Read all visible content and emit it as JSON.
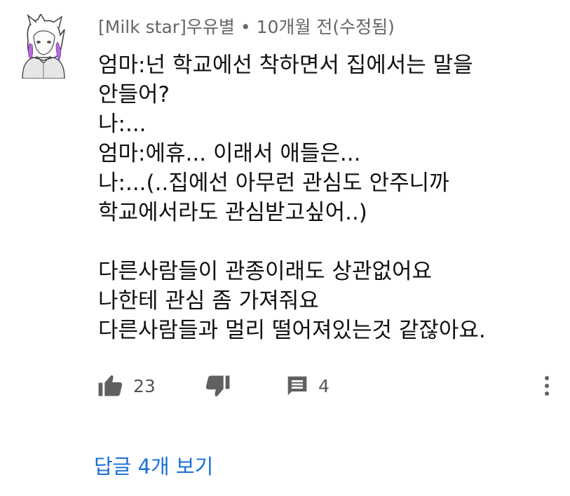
{
  "comment": {
    "author": "[Milk star]우유별",
    "separator": "•",
    "time": "10개월 전(수정됨)",
    "lines": [
      "엄마:넌 학교에선 착하면서 집에서는 말을",
      "안들어?",
      "나:...",
      "엄마:에휴... 이래서 애들은...",
      "나:...(..집에선 아무런 관심도 안주니까",
      "학교에서라도 관심받고싶어..)",
      "",
      "다른사람들이 관종이래도 상관없어요",
      "나한테 관심 좀 가져줘요",
      "다른사람들과 멀리 떨어져있는것 같잖아요."
    ],
    "avatar_icon": "anime-character-avatar-icon"
  },
  "actions": {
    "like_icon": "thumbs-up-icon",
    "like_count": "23",
    "dislike_icon": "thumbs-down-icon",
    "reply_icon": "comment-icon",
    "reply_count": "4",
    "more_icon": "more-vertical-icon"
  },
  "replies": {
    "label": "답글 4개 보기",
    "color": "#1a6ed8"
  }
}
